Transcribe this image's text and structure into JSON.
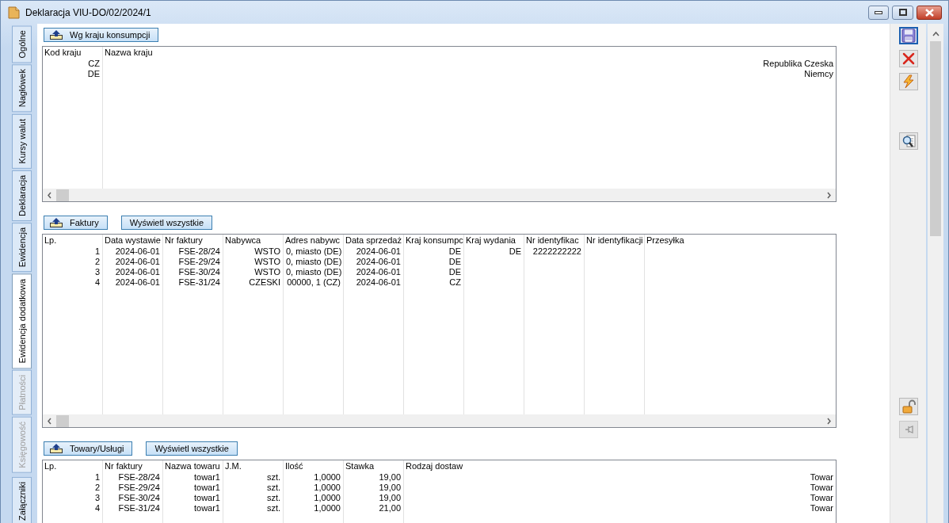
{
  "window": {
    "title": "Deklaracja VIU-DO/02/2024/1"
  },
  "side_tabs": [
    {
      "label": "Ogólne",
      "selected": false,
      "disabled": false
    },
    {
      "label": "Nagłówek",
      "selected": false,
      "disabled": false
    },
    {
      "label": "Kursy walut",
      "selected": false,
      "disabled": false
    },
    {
      "label": "Deklaracja",
      "selected": false,
      "disabled": false
    },
    {
      "label": "Ewidencja",
      "selected": false,
      "disabled": false
    },
    {
      "label": "Ewidencja dodatkowa",
      "selected": true,
      "disabled": false
    },
    {
      "label": "Płatności",
      "selected": false,
      "disabled": true
    },
    {
      "label": "Księgowość",
      "selected": false,
      "disabled": true
    },
    {
      "label": "Załączniki",
      "selected": false,
      "disabled": false
    }
  ],
  "sections": [
    {
      "button": "Wg kraju konsumpcji",
      "table": {
        "columns": [
          "Kod kraju",
          "Nazwa kraju"
        ],
        "rows": [
          [
            "CZ",
            "Republika Czeska"
          ],
          [
            "DE",
            "Niemcy"
          ]
        ]
      }
    },
    {
      "button": "Faktury",
      "show_all": "Wyświetl wszystkie",
      "table": {
        "columns": [
          "Lp.",
          "Data wystawie",
          "Nr faktury",
          "Nabywca",
          "Adres nabywc",
          "Data sprzedaż",
          "Kraj konsumpc",
          "Kraj wydania",
          "Nr identyfikac",
          "Nr identyfikacji",
          "Przesyłka"
        ],
        "rows": [
          [
            "1",
            "2024-06-01",
            "FSE-28/24",
            "WSTO",
            "0, miasto (DE)",
            "2024-06-01",
            "DE",
            "DE",
            "2222222222"
          ],
          [
            "2",
            "2024-06-01",
            "FSE-29/24",
            "WSTO",
            "0, miasto (DE)",
            "2024-06-01",
            "DE"
          ],
          [
            "3",
            "2024-06-01",
            "FSE-30/24",
            "WSTO",
            "0, miasto (DE)",
            "2024-06-01",
            "DE"
          ],
          [
            "4",
            "2024-06-01",
            "FSE-31/24",
            "CZESKI",
            "00000, 1 (CZ)",
            "2024-06-01",
            "CZ"
          ]
        ]
      }
    },
    {
      "button": "Towary/Usługi",
      "show_all": "Wyświetl wszystkie",
      "table": {
        "columns": [
          "Lp.",
          "Nr faktury",
          "Nazwa towaru",
          "J.M.",
          "Ilość",
          "Stawka",
          "Rodzaj dostaw"
        ],
        "rows": [
          [
            "1",
            "FSE-28/24",
            "towar1",
            "szt.",
            "1,0000",
            "19,00",
            "Towar"
          ],
          [
            "2",
            "FSE-29/24",
            "towar1",
            "szt.",
            "1,0000",
            "19,00",
            "Towar"
          ],
          [
            "3",
            "FSE-30/24",
            "towar1",
            "szt.",
            "1,0000",
            "19,00",
            "Towar"
          ],
          [
            "4",
            "FSE-31/24",
            "towar1",
            "szt.",
            "1,0000",
            "21,00",
            "Towar"
          ]
        ]
      }
    }
  ],
  "toolbar_top": [
    {
      "kind": "save",
      "focused": true,
      "disabled": false
    },
    {
      "kind": "delete",
      "focused": false,
      "disabled": false
    },
    {
      "kind": "execute",
      "focused": false,
      "disabled": false
    }
  ],
  "toolbar_middle": [
    {
      "kind": "preview",
      "focused": false,
      "disabled": false
    }
  ],
  "toolbar_bottom": [
    {
      "kind": "lock",
      "focused": false,
      "disabled": false
    },
    {
      "kind": "pin",
      "focused": false,
      "disabled": true
    }
  ]
}
